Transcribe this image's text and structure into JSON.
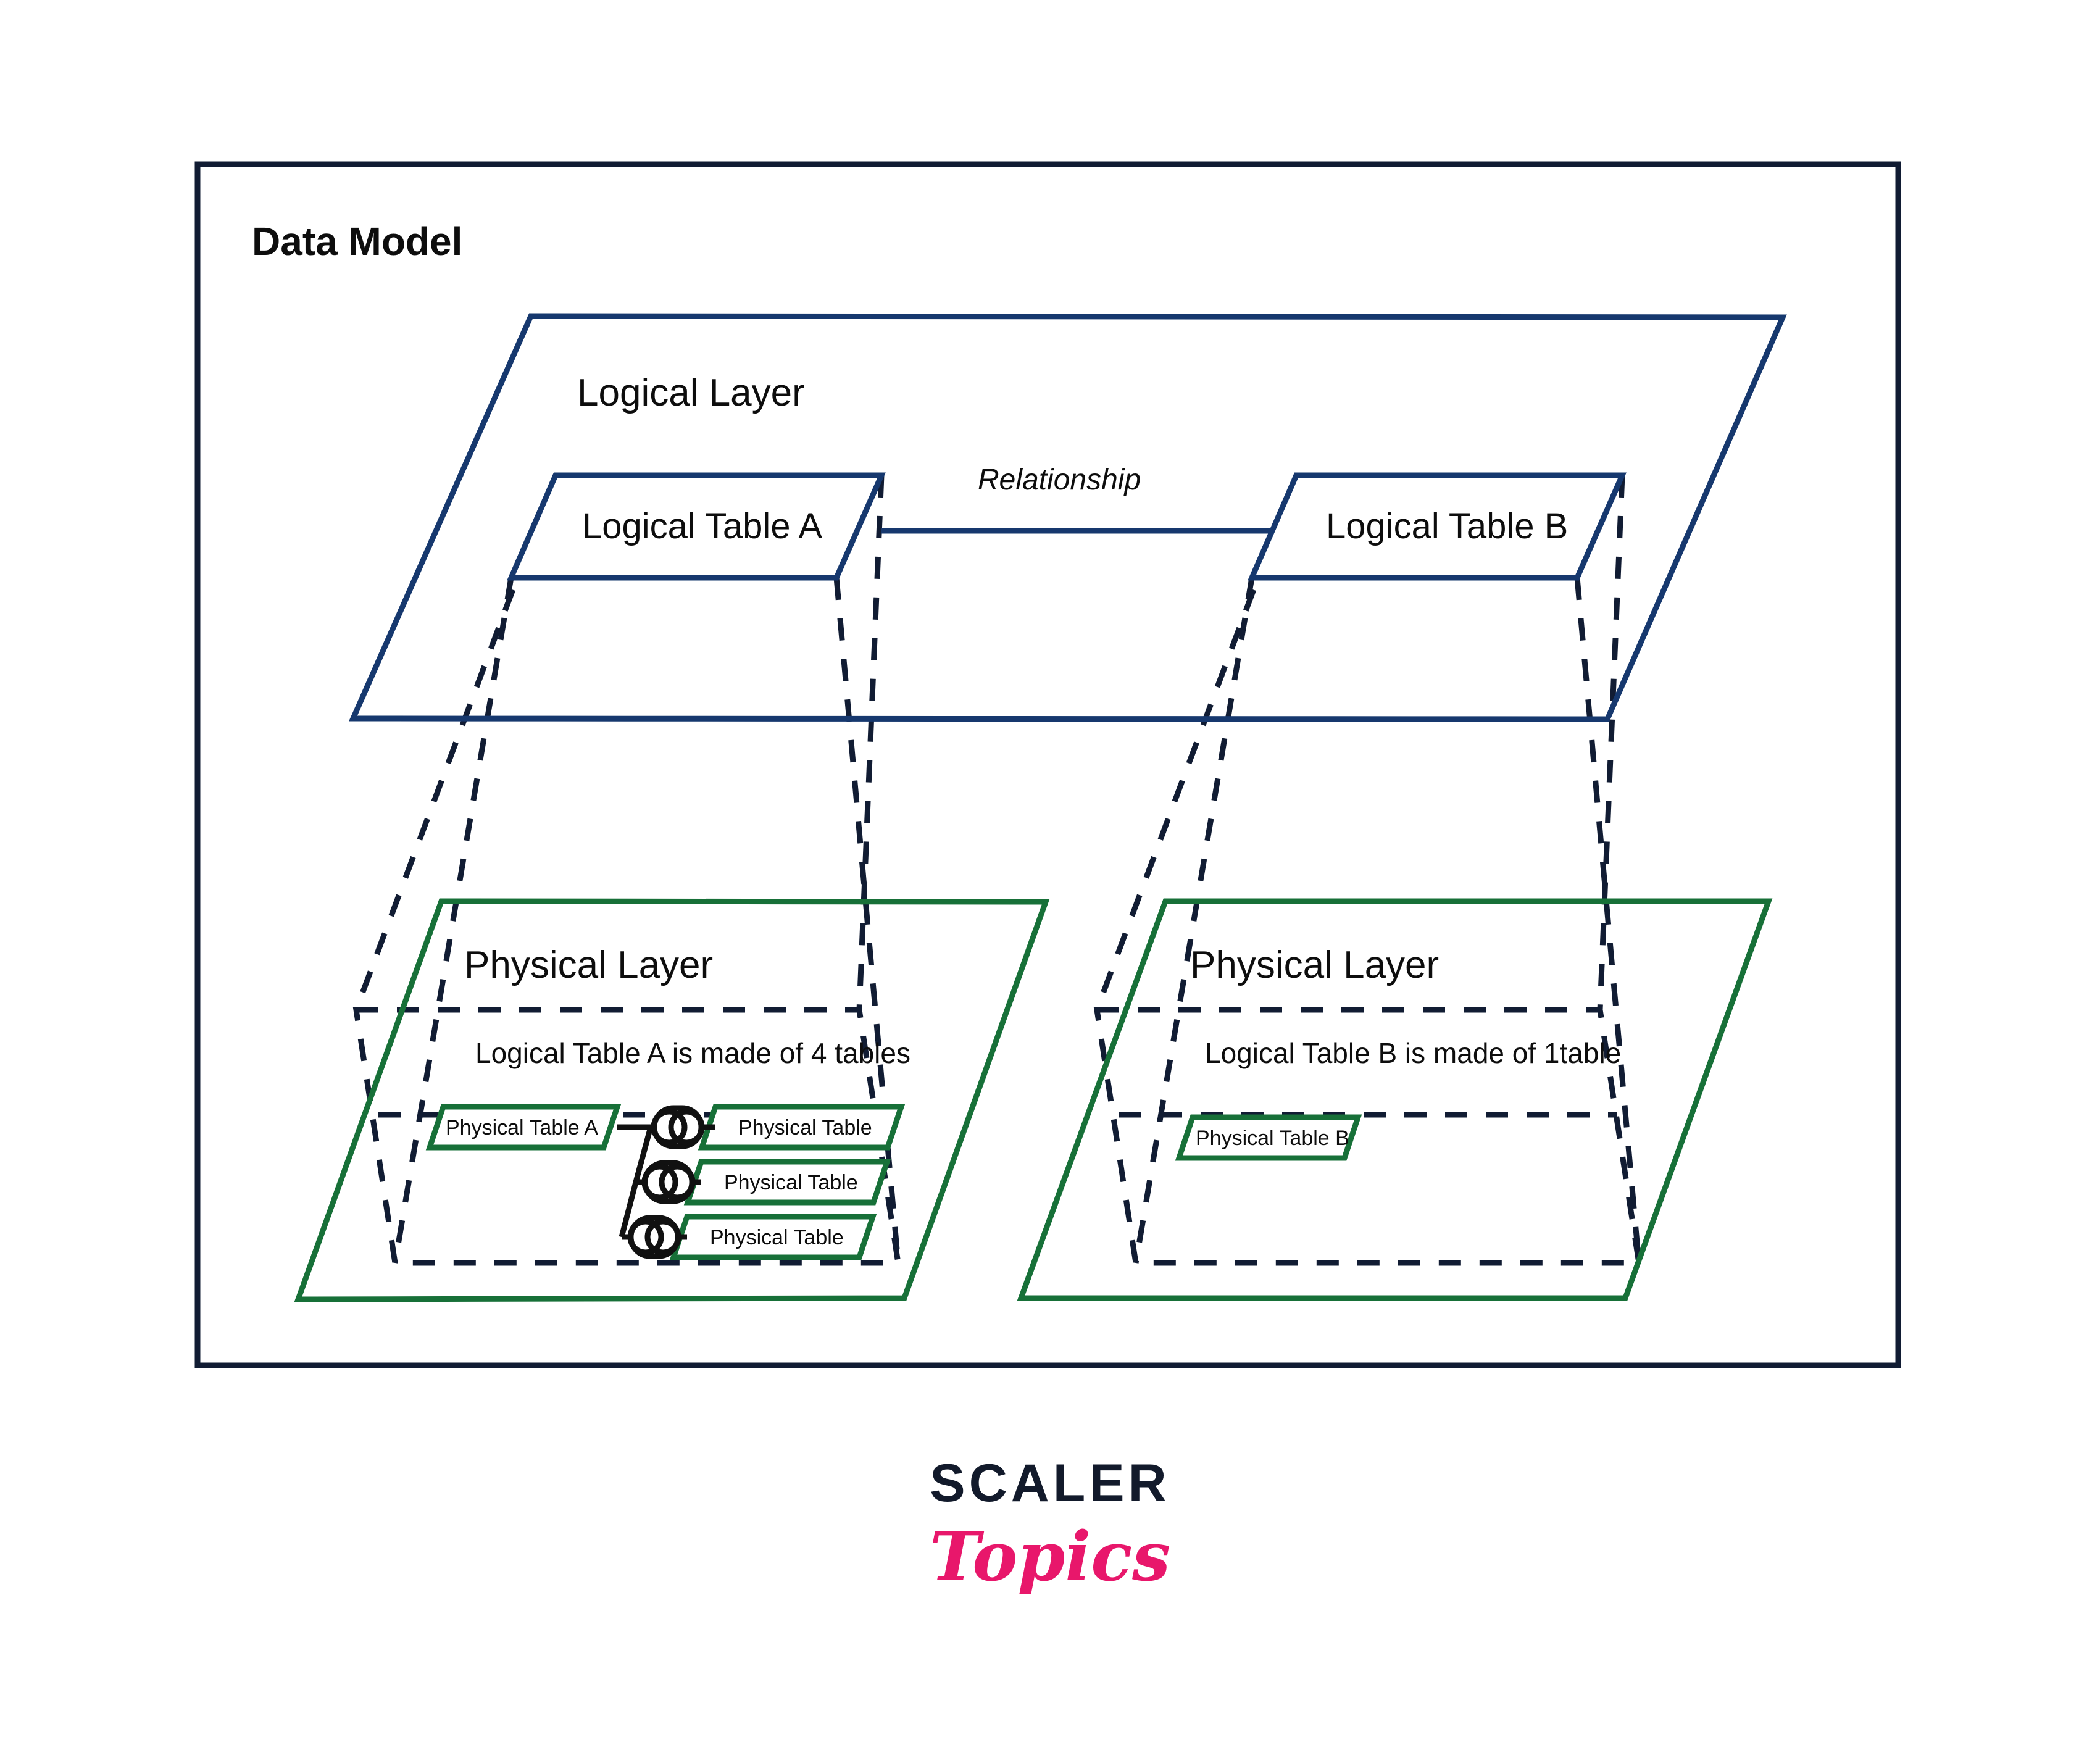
{
  "diagram": {
    "title": "Data Model",
    "logical_layer": {
      "label": "Logical Layer",
      "tables": [
        {
          "label": "Logical Table A"
        },
        {
          "label": "Logical Table B"
        }
      ],
      "relationship_label": "Relationship"
    },
    "physical_layers": [
      {
        "label": "Physical Layer",
        "description": "Logical Table A is made of 4 tables",
        "tables": [
          {
            "label": "Physical Table A"
          },
          {
            "label": "Physical Table"
          },
          {
            "label": "Physical Table"
          },
          {
            "label": "Physical Table"
          }
        ],
        "join_icon": "venn-join-icon",
        "join_count": 3
      },
      {
        "label": "Physical Layer",
        "description": "Logical Table B is made of 1table",
        "tables": [
          {
            "label": "Physical Table B"
          }
        ],
        "join_icon": "venn-join-icon",
        "join_count": 0
      }
    ]
  },
  "branding": {
    "logo_primary": "SCALER",
    "logo_secondary": "Topics"
  },
  "colors": {
    "frame": "#111c33",
    "logical_blue": "#16386e",
    "physical_green": "#177038",
    "dashed": "#111c33",
    "text": "#0d0d0d",
    "logo_dark": "#121a2b",
    "logo_pink": "#e8176b",
    "background": "#ffffff"
  }
}
